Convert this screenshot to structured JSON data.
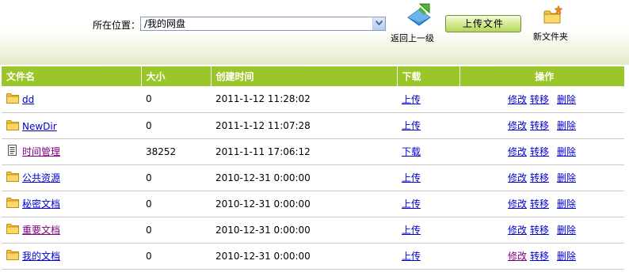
{
  "toolbar": {
    "location_label": "所在位置：",
    "location_value": "/我的网盘",
    "up_label": "返回上一级",
    "upload_label": "上传文件",
    "new_folder_label": "新文件夹"
  },
  "table": {
    "headers": {
      "name": "文件名",
      "size": "大小",
      "created": "创建时间",
      "download": "下载",
      "ops": "操作"
    },
    "op_labels": {
      "edit": "修改",
      "move": "转移",
      "delete": "删除"
    },
    "rows": [
      {
        "name": "dd",
        "type": "folder-icon",
        "size": "0",
        "created": "2011-1-12 11:28:02",
        "action": "上传"
      },
      {
        "name": "NewDir",
        "type": "folder-icon",
        "size": "0",
        "created": "2011-1-12 11:07:28",
        "action": "上传"
      },
      {
        "name": "时间管理",
        "type": "document-icon",
        "size": "38252",
        "created": "2011-1-11 17:06:12",
        "action": "下载"
      },
      {
        "name": "公共资源",
        "type": "folder-icon",
        "size": "0",
        "created": "2010-12-31 0:00:00",
        "action": "上传"
      },
      {
        "name": "秘密文档",
        "type": "folder-icon",
        "size": "0",
        "created": "2010-12-31 0:00:00",
        "action": "上传"
      },
      {
        "name": "重要文档",
        "type": "folder-icon",
        "size": "0",
        "created": "2010-12-31 0:00:00",
        "action": "上传"
      },
      {
        "name": "我的文档",
        "type": "folder-icon",
        "size": "0",
        "created": "2010-12-31 0:00:00",
        "action": "上传"
      }
    ]
  },
  "colors": {
    "header_bg": "#9ac62a",
    "link": "#0000cc",
    "visited_link": "#800080"
  }
}
